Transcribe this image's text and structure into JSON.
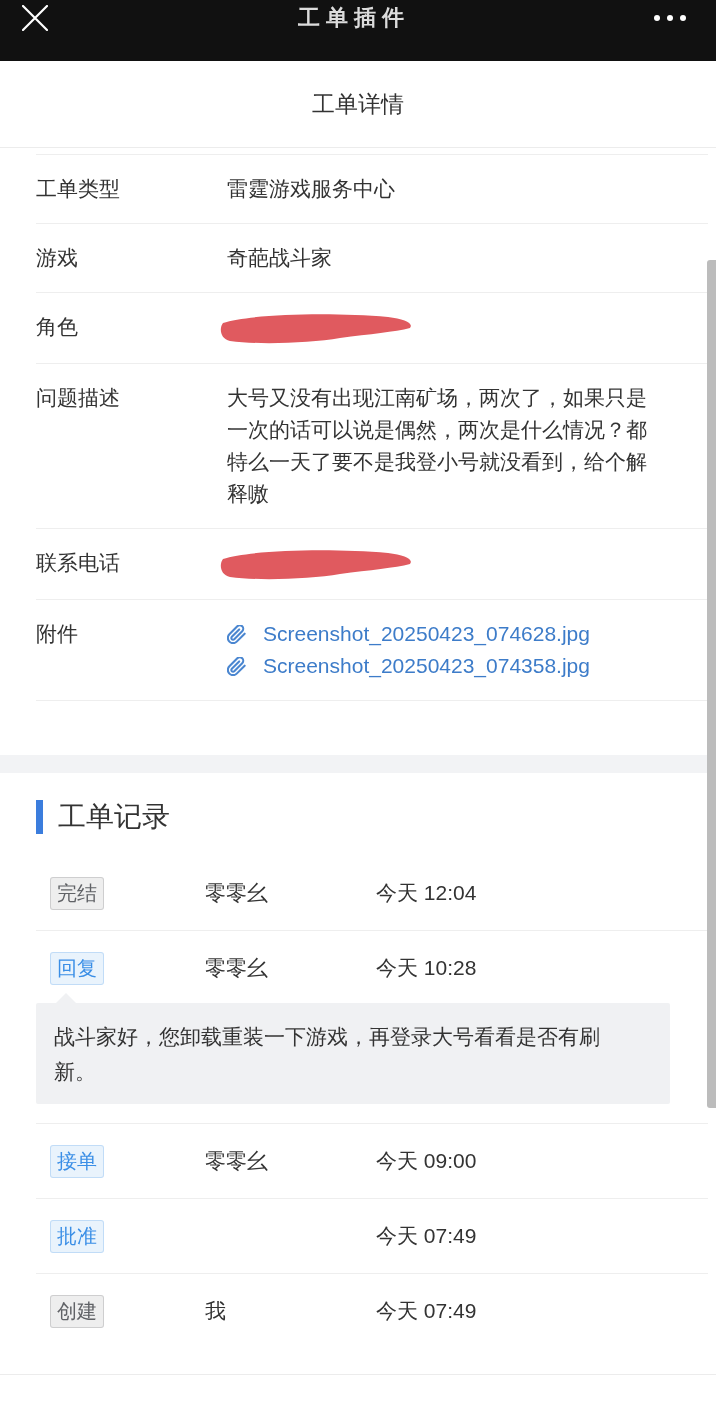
{
  "top_bar": {
    "title": "工单插件"
  },
  "header": {
    "title": "工单详情"
  },
  "details": [
    {
      "label": "工单类型",
      "kind": "text",
      "value": "雷霆游戏服务中心"
    },
    {
      "label": "游戏",
      "kind": "text",
      "value": "奇葩战斗家"
    },
    {
      "label": "角色",
      "kind": "redacted"
    },
    {
      "label": "问题描述",
      "kind": "text",
      "value": "大号又没有出现江南矿场，两次了，如果只是一次的话可以说是偶然，两次是什么情况？都特么一天了要不是我登小号就没看到，给个解释嗷"
    },
    {
      "label": "联系电话",
      "kind": "redacted"
    },
    {
      "label": "附件",
      "kind": "attachments",
      "files": [
        "Screenshot_20250423_074628.jpg",
        "Screenshot_20250423_074358.jpg"
      ]
    }
  ],
  "records": {
    "title": "工单记录",
    "items": [
      {
        "tag": "完结",
        "color": "#606266",
        "name": "零零幺",
        "time": "今天 12:04"
      },
      {
        "tag": "回复",
        "color": "#3a8ee6",
        "name": "零零幺",
        "time": "今天 10:28",
        "reply": "战斗家好，您卸载重装一下游戏，再登录大号看看是否有刷新。"
      },
      {
        "tag": "接单",
        "color": "#3a8ee6",
        "name": "零零幺",
        "time": "今天 09:00"
      },
      {
        "tag": "批准",
        "color": "#3a8ee6",
        "time": "今天 07:49"
      },
      {
        "tag": "创建",
        "color": "#606266",
        "name": "我",
        "time": "今天 07:49"
      }
    ]
  }
}
